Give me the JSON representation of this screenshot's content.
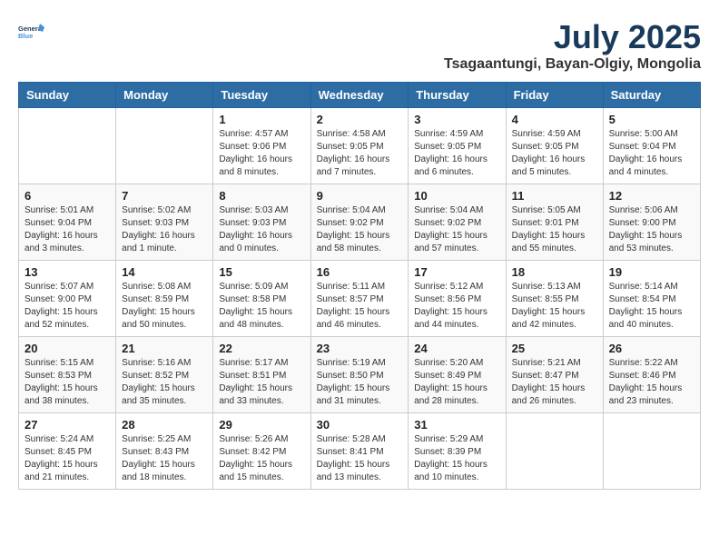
{
  "header": {
    "logo_line1": "General",
    "logo_line2": "Blue",
    "month": "July 2025",
    "location": "Tsagaantungi, Bayan-Olgiy, Mongolia"
  },
  "days_of_week": [
    "Sunday",
    "Monday",
    "Tuesday",
    "Wednesday",
    "Thursday",
    "Friday",
    "Saturday"
  ],
  "weeks": [
    [
      {
        "day": "",
        "info": ""
      },
      {
        "day": "",
        "info": ""
      },
      {
        "day": "1",
        "info": "Sunrise: 4:57 AM\nSunset: 9:06 PM\nDaylight: 16 hours\nand 8 minutes."
      },
      {
        "day": "2",
        "info": "Sunrise: 4:58 AM\nSunset: 9:05 PM\nDaylight: 16 hours\nand 7 minutes."
      },
      {
        "day": "3",
        "info": "Sunrise: 4:59 AM\nSunset: 9:05 PM\nDaylight: 16 hours\nand 6 minutes."
      },
      {
        "day": "4",
        "info": "Sunrise: 4:59 AM\nSunset: 9:05 PM\nDaylight: 16 hours\nand 5 minutes."
      },
      {
        "day": "5",
        "info": "Sunrise: 5:00 AM\nSunset: 9:04 PM\nDaylight: 16 hours\nand 4 minutes."
      }
    ],
    [
      {
        "day": "6",
        "info": "Sunrise: 5:01 AM\nSunset: 9:04 PM\nDaylight: 16 hours\nand 3 minutes."
      },
      {
        "day": "7",
        "info": "Sunrise: 5:02 AM\nSunset: 9:03 PM\nDaylight: 16 hours\nand 1 minute."
      },
      {
        "day": "8",
        "info": "Sunrise: 5:03 AM\nSunset: 9:03 PM\nDaylight: 16 hours\nand 0 minutes."
      },
      {
        "day": "9",
        "info": "Sunrise: 5:04 AM\nSunset: 9:02 PM\nDaylight: 15 hours\nand 58 minutes."
      },
      {
        "day": "10",
        "info": "Sunrise: 5:04 AM\nSunset: 9:02 PM\nDaylight: 15 hours\nand 57 minutes."
      },
      {
        "day": "11",
        "info": "Sunrise: 5:05 AM\nSunset: 9:01 PM\nDaylight: 15 hours\nand 55 minutes."
      },
      {
        "day": "12",
        "info": "Sunrise: 5:06 AM\nSunset: 9:00 PM\nDaylight: 15 hours\nand 53 minutes."
      }
    ],
    [
      {
        "day": "13",
        "info": "Sunrise: 5:07 AM\nSunset: 9:00 PM\nDaylight: 15 hours\nand 52 minutes."
      },
      {
        "day": "14",
        "info": "Sunrise: 5:08 AM\nSunset: 8:59 PM\nDaylight: 15 hours\nand 50 minutes."
      },
      {
        "day": "15",
        "info": "Sunrise: 5:09 AM\nSunset: 8:58 PM\nDaylight: 15 hours\nand 48 minutes."
      },
      {
        "day": "16",
        "info": "Sunrise: 5:11 AM\nSunset: 8:57 PM\nDaylight: 15 hours\nand 46 minutes."
      },
      {
        "day": "17",
        "info": "Sunrise: 5:12 AM\nSunset: 8:56 PM\nDaylight: 15 hours\nand 44 minutes."
      },
      {
        "day": "18",
        "info": "Sunrise: 5:13 AM\nSunset: 8:55 PM\nDaylight: 15 hours\nand 42 minutes."
      },
      {
        "day": "19",
        "info": "Sunrise: 5:14 AM\nSunset: 8:54 PM\nDaylight: 15 hours\nand 40 minutes."
      }
    ],
    [
      {
        "day": "20",
        "info": "Sunrise: 5:15 AM\nSunset: 8:53 PM\nDaylight: 15 hours\nand 38 minutes."
      },
      {
        "day": "21",
        "info": "Sunrise: 5:16 AM\nSunset: 8:52 PM\nDaylight: 15 hours\nand 35 minutes."
      },
      {
        "day": "22",
        "info": "Sunrise: 5:17 AM\nSunset: 8:51 PM\nDaylight: 15 hours\nand 33 minutes."
      },
      {
        "day": "23",
        "info": "Sunrise: 5:19 AM\nSunset: 8:50 PM\nDaylight: 15 hours\nand 31 minutes."
      },
      {
        "day": "24",
        "info": "Sunrise: 5:20 AM\nSunset: 8:49 PM\nDaylight: 15 hours\nand 28 minutes."
      },
      {
        "day": "25",
        "info": "Sunrise: 5:21 AM\nSunset: 8:47 PM\nDaylight: 15 hours\nand 26 minutes."
      },
      {
        "day": "26",
        "info": "Sunrise: 5:22 AM\nSunset: 8:46 PM\nDaylight: 15 hours\nand 23 minutes."
      }
    ],
    [
      {
        "day": "27",
        "info": "Sunrise: 5:24 AM\nSunset: 8:45 PM\nDaylight: 15 hours\nand 21 minutes."
      },
      {
        "day": "28",
        "info": "Sunrise: 5:25 AM\nSunset: 8:43 PM\nDaylight: 15 hours\nand 18 minutes."
      },
      {
        "day": "29",
        "info": "Sunrise: 5:26 AM\nSunset: 8:42 PM\nDaylight: 15 hours\nand 15 minutes."
      },
      {
        "day": "30",
        "info": "Sunrise: 5:28 AM\nSunset: 8:41 PM\nDaylight: 15 hours\nand 13 minutes."
      },
      {
        "day": "31",
        "info": "Sunrise: 5:29 AM\nSunset: 8:39 PM\nDaylight: 15 hours\nand 10 minutes."
      },
      {
        "day": "",
        "info": ""
      },
      {
        "day": "",
        "info": ""
      }
    ]
  ]
}
